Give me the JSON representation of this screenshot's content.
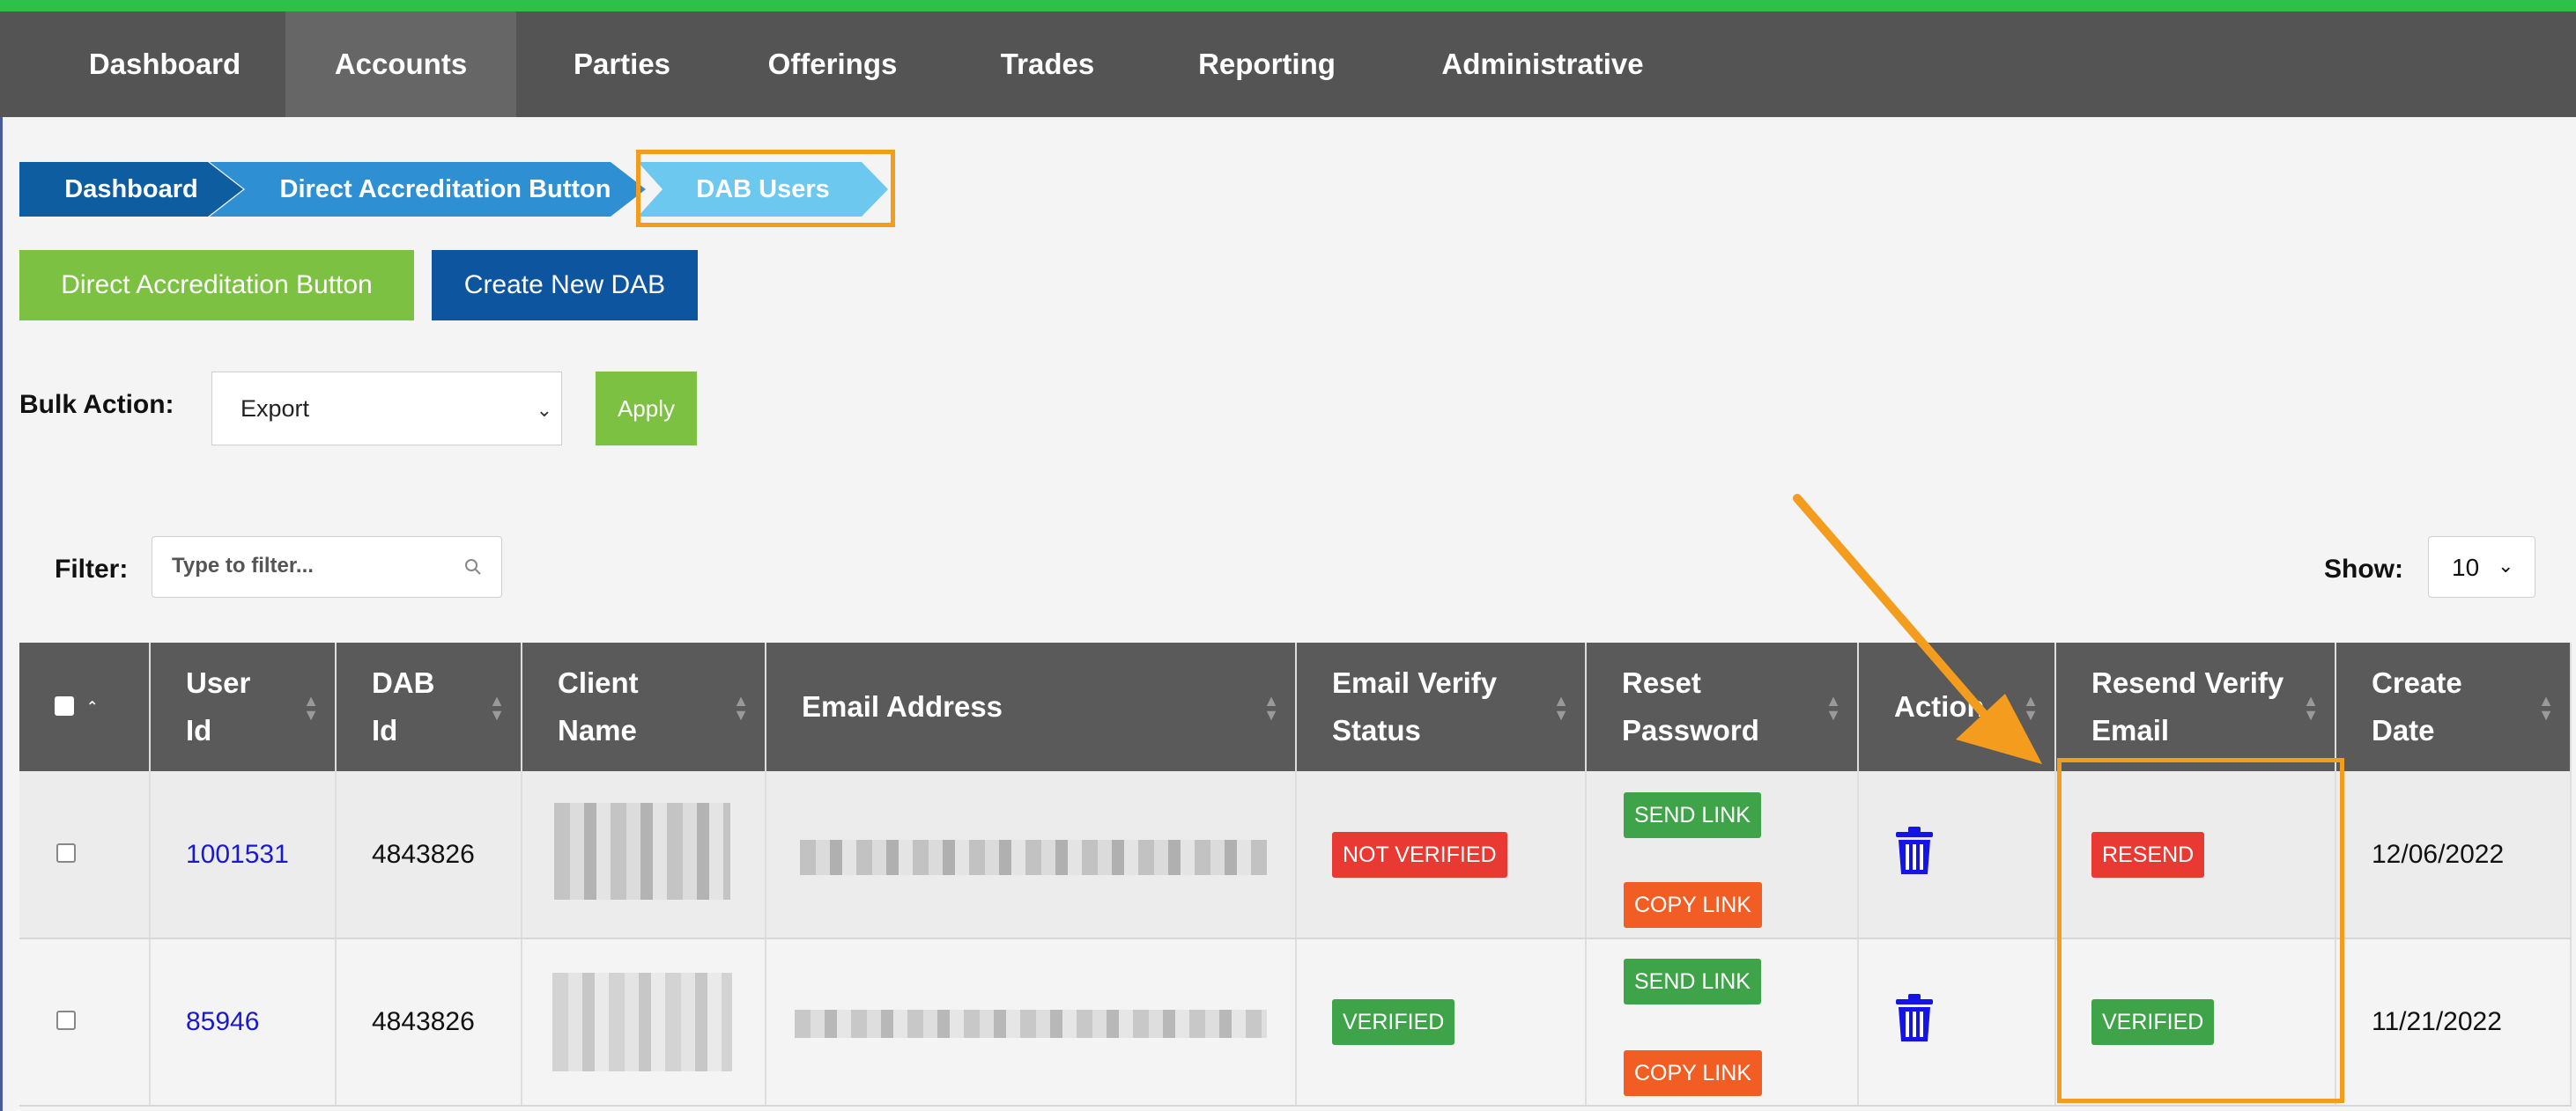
{
  "nav": {
    "items": [
      "Dashboard",
      "Accounts",
      "Parties",
      "Offerings",
      "Trades",
      "Reporting",
      "Administrative"
    ],
    "active": "Accounts"
  },
  "breadcrumb": [
    "Dashboard",
    "Direct Accreditation Button",
    "DAB Users"
  ],
  "buttons": {
    "direct_accreditation": "Direct Accreditation Button",
    "create_new_dab": "Create New DAB",
    "apply": "Apply"
  },
  "bulk_action": {
    "label": "Bulk Action:",
    "selected": "Export"
  },
  "filter": {
    "label": "Filter:",
    "placeholder": "Type to filter..."
  },
  "show": {
    "label": "Show:",
    "selected": "10"
  },
  "table": {
    "headers": [
      "User Id",
      "DAB Id",
      "Client Name",
      "Email Address",
      "Email Verify Status",
      "Reset Password",
      "Action",
      "Resend Verify Email",
      "Create Date"
    ],
    "rows": [
      {
        "user_id": "1001531",
        "dab_id": "4843826",
        "email_status": "NOT VERIFIED",
        "send_link": "SEND LINK",
        "copy_link": "COPY LINK",
        "resend": "RESEND",
        "create_date": "12/06/2022"
      },
      {
        "user_id": "85946",
        "dab_id": "4843826",
        "email_status": "VERIFIED",
        "send_link": "SEND LINK",
        "copy_link": "COPY LINK",
        "resend": "VERIFIED",
        "create_date": "11/21/2022"
      }
    ]
  },
  "colors": {
    "nav_bg": "#545454",
    "accent_green": "#7cc142",
    "primary_blue": "#0d559e",
    "annotation_orange": "#f39c1e",
    "badge_red": "#e83a32",
    "badge_green": "#3fa34a",
    "badge_orange": "#f15d23"
  }
}
